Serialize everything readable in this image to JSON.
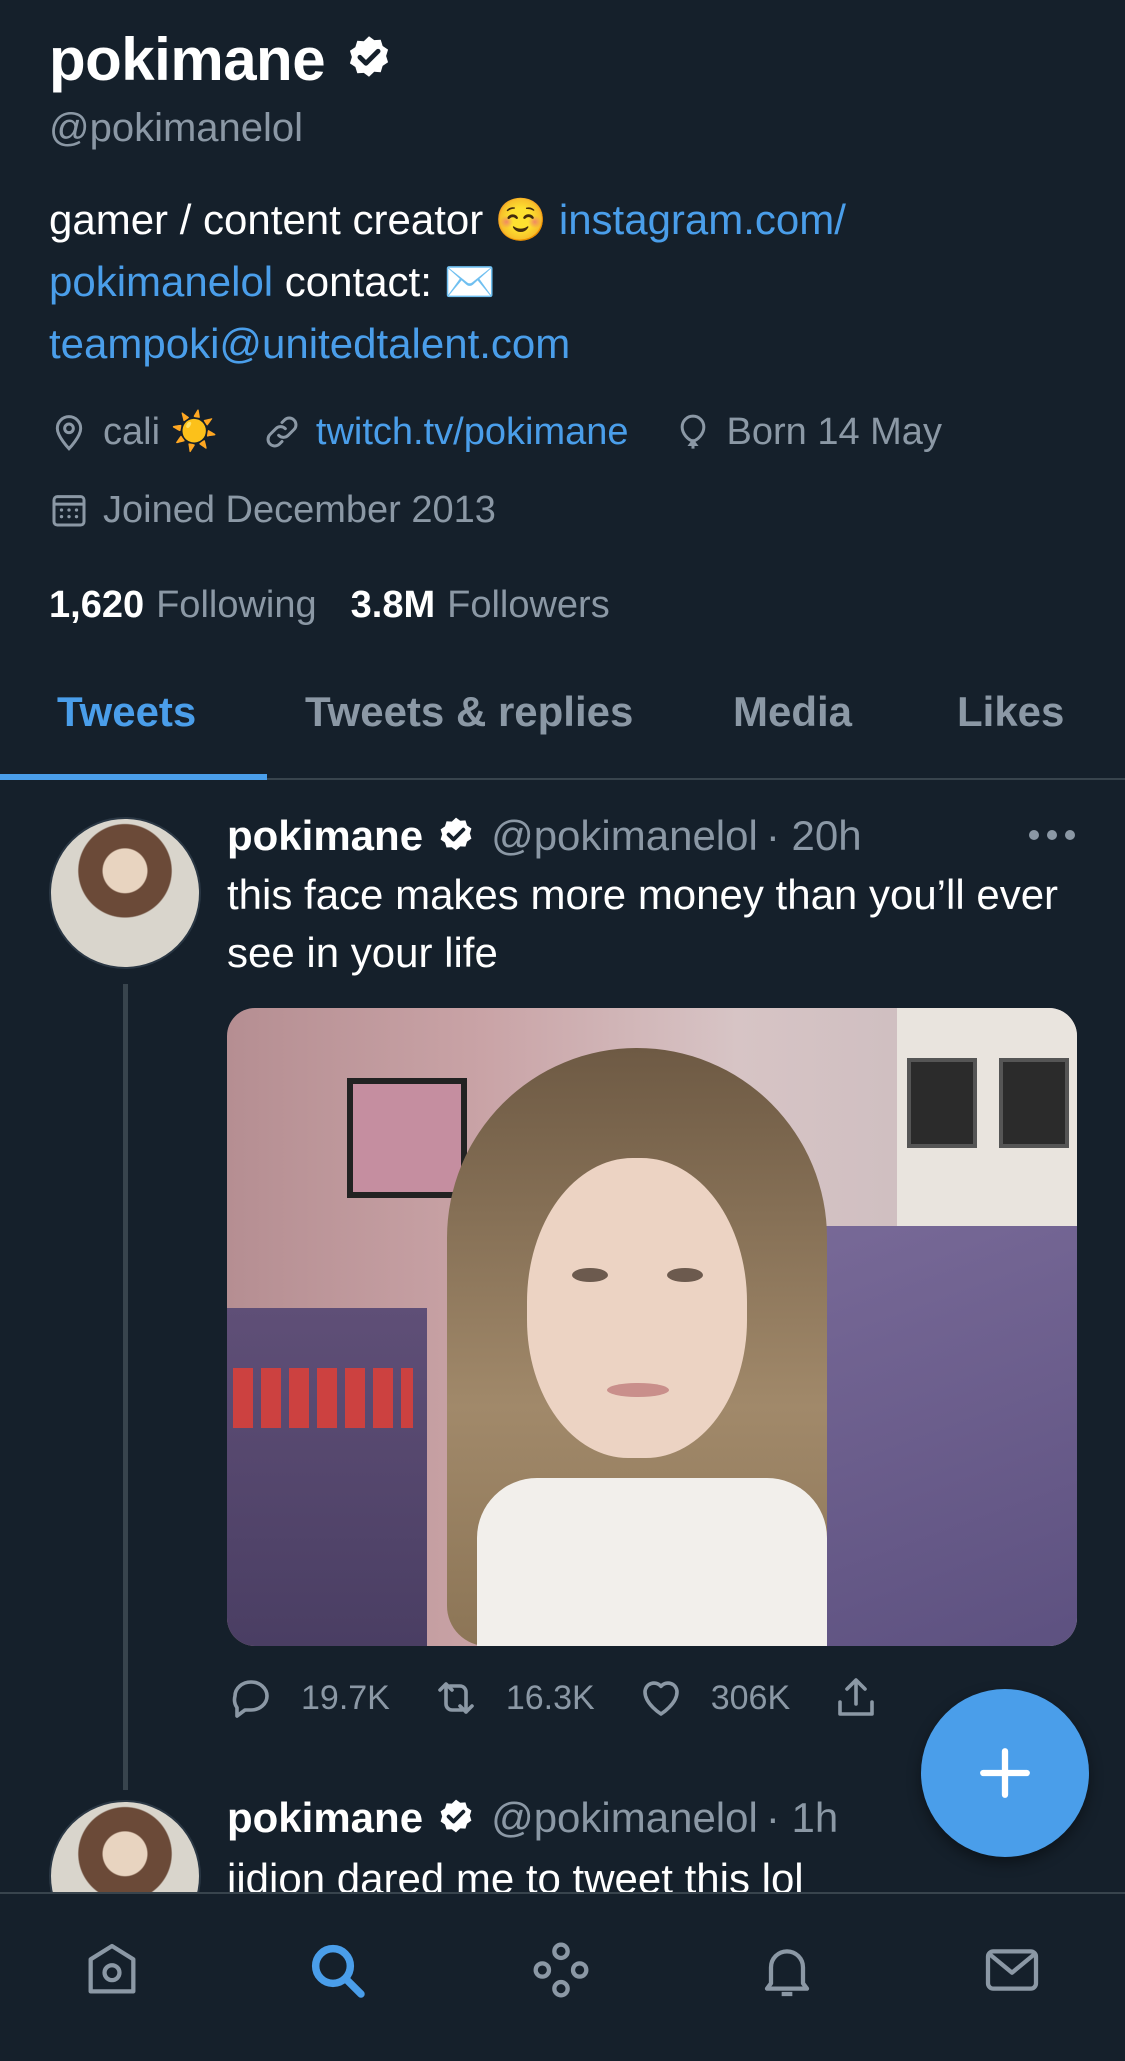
{
  "profile": {
    "display_name": "pokimane",
    "handle": "@pokimanelol",
    "bio": {
      "text1": "gamer / content creator ",
      "emoji1": "☺️",
      "link1": "instagram.com/",
      "link1b": "pokimanelol",
      "text2": " contact: ",
      "emoji2": "✉️",
      "link2": "teampoki@unitedtalent.com"
    },
    "location": "cali",
    "location_emoji": "☀️",
    "website": "twitch.tv/pokimane",
    "birthday": "Born 14 May",
    "joined": "Joined December 2013",
    "following_count": "1,620",
    "following_label": "Following",
    "followers_count": "3.8M",
    "followers_label": "Followers"
  },
  "tabs": [
    {
      "label": "Tweets",
      "active": true
    },
    {
      "label": "Tweets & replies",
      "active": false
    },
    {
      "label": "Media",
      "active": false
    },
    {
      "label": "Likes",
      "active": false
    }
  ],
  "tweets": [
    {
      "name": "pokimane",
      "handle": "@pokimanelol",
      "time": "· 20h",
      "text": "this face makes more money than you’ll ever see in your life",
      "replies": "19.7K",
      "retweets": "16.3K",
      "likes": "306K"
    },
    {
      "name": "pokimane",
      "handle": "@pokimanelol",
      "time": "· 1h",
      "text": "jidion dared me to tweet this lol"
    }
  ],
  "colors": {
    "background": "#15202b",
    "accent": "#4a9eea",
    "secondary_text": "#8b98a5",
    "divider": "#38444d"
  },
  "icons": {
    "nav": [
      "home-icon",
      "search-icon",
      "spaces-icon",
      "notifications-icon",
      "messages-icon"
    ],
    "fab": "compose-plus-icon"
  }
}
